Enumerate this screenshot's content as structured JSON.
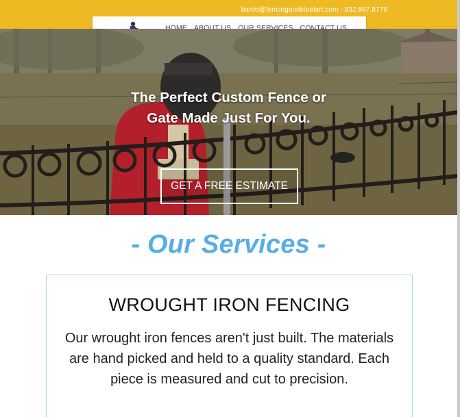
{
  "topbar": {
    "email": "bardo@fencingandsteelart.com",
    "separator": " - ",
    "phone": "832.867.8776",
    "color": "#efb924"
  },
  "nav": {
    "logo_icon": "welder-logo-icon",
    "items": [
      {
        "label": "HOME"
      },
      {
        "label": "ABOUT US"
      },
      {
        "label": "OUR SERVICES"
      },
      {
        "label": "CONTACT US"
      }
    ]
  },
  "hero": {
    "title_line1": "The Perfect Custom Fence or",
    "title_line2": "Gate Made Just For You.",
    "cta_label": "GET A FREE ESTIMATE"
  },
  "services": {
    "heading": "- Our Services -",
    "accent_color": "#57aee4",
    "card": {
      "title": "WROUGHT IRON FENCING",
      "description": "Our wrought iron fences aren't just built. The materials are hand picked and held to a quality standard. Each piece is measured and cut to precision."
    }
  }
}
